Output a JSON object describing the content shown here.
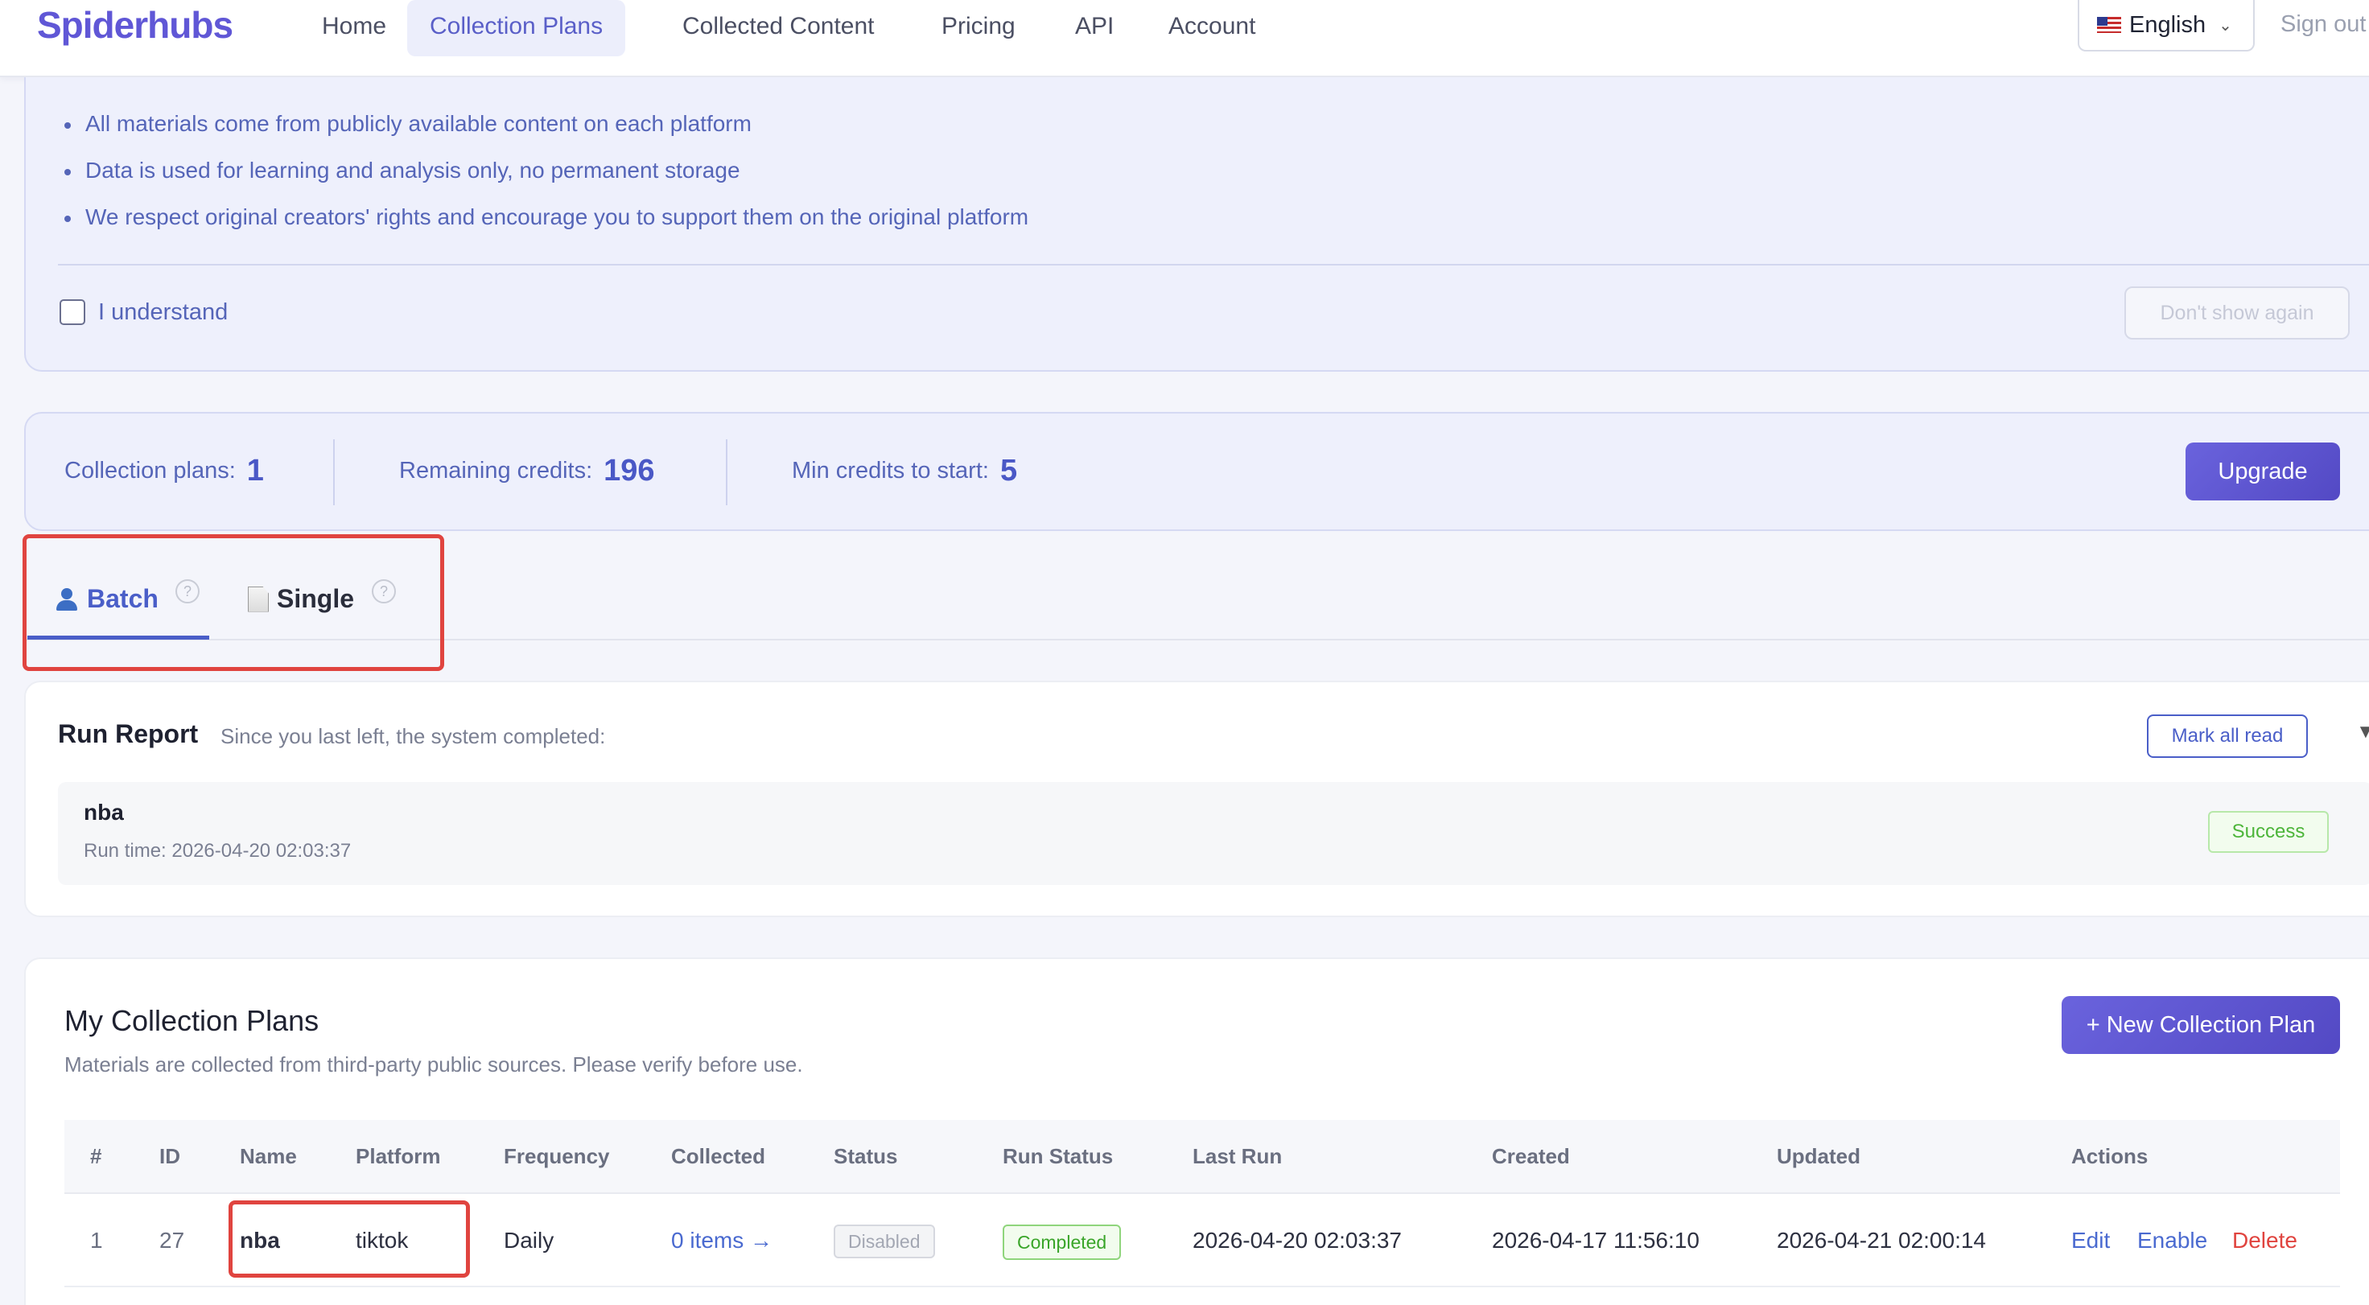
{
  "nav": {
    "logo": "Spiderhubs",
    "items": [
      {
        "label": "Home",
        "active": false
      },
      {
        "label": "Collection Plans",
        "active": true
      },
      {
        "label": "Collected Content",
        "active": false
      },
      {
        "label": "Pricing",
        "active": false
      },
      {
        "label": "API",
        "active": false
      },
      {
        "label": "Account",
        "active": false
      }
    ],
    "language": "English",
    "sign_out": "Sign out"
  },
  "notice": {
    "lines": [
      "All materials come from publicly available content on each platform",
      "Data is used for learning and analysis only, no permanent storage",
      "We respect original creators' rights and encourage you to support them on the original platform"
    ],
    "checkbox_label": "I understand",
    "checkbox_checked": false,
    "dont_show_label": "Don't show again"
  },
  "stats": {
    "plans_label": "Collection plans:",
    "plans_value": "1",
    "credits_label": "Remaining credits:",
    "credits_value": "196",
    "min_label": "Min credits to start:",
    "min_value": "5",
    "upgrade_label": "Upgrade"
  },
  "tabs": [
    {
      "label": "Batch",
      "icon": "user-icon",
      "active": true,
      "help": "?"
    },
    {
      "label": "Single",
      "icon": "document-icon",
      "active": false,
      "help": "?"
    }
  ],
  "run_report": {
    "title": "Run Report",
    "subtitle": "Since you last left, the system completed:",
    "mark_all_read": "Mark all read",
    "collapse": "▼",
    "items": [
      {
        "name": "nba",
        "time": "Run time: 2026-04-20 02:03:37",
        "status": "Success"
      }
    ]
  },
  "plans": {
    "title": "My Collection Plans",
    "subtitle": "Materials are collected from third-party public sources. Please verify before use.",
    "new_button": "+ New Collection Plan",
    "columns": [
      "#",
      "ID",
      "Name",
      "Platform",
      "Frequency",
      "Collected",
      "Status",
      "Run Status",
      "Last Run",
      "Created",
      "Updated",
      "Actions"
    ],
    "rows": [
      {
        "index": "1",
        "id": "27",
        "name": "nba",
        "platform": "tiktok",
        "frequency": "Daily",
        "collected": "0 items →",
        "status": "Disabled",
        "run_status": "Completed",
        "last_run": "2026-04-20 02:03:37",
        "created": "2026-04-17 11:56:10",
        "updated": "2026-04-21 02:00:14",
        "actions": {
          "edit": "Edit",
          "enable": "Enable",
          "delete": "Delete"
        }
      }
    ]
  },
  "colors": {
    "brand": "#6057d6",
    "accent": "#4a5ec8",
    "success": "#4db53a",
    "danger": "#e0443f",
    "highlight_box": "#e0443f"
  }
}
